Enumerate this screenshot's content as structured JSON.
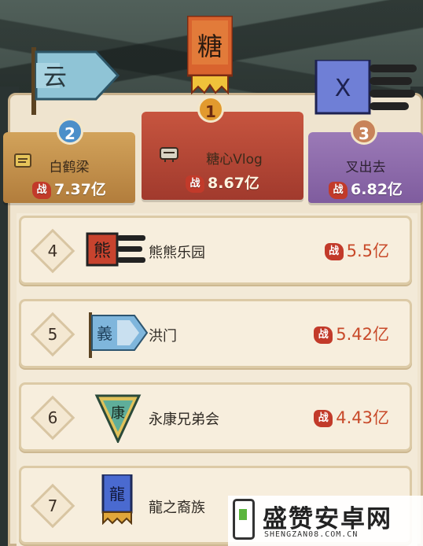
{
  "podium": [
    {
      "rank": "1",
      "name": "糖心Vlog",
      "score": "8.67亿",
      "flag_text": "糖",
      "color": "#b8432f"
    },
    {
      "rank": "2",
      "name": "白鹤梁",
      "score": "7.37亿",
      "flag_text": "云",
      "color": "#c4904a"
    },
    {
      "rank": "3",
      "name": "叉出去",
      "score": "6.82亿",
      "flag_text": "X",
      "color": "#8d6aab"
    }
  ],
  "power_label": "战",
  "list": [
    {
      "rank": "4",
      "name": "熊熊乐园",
      "score": "5.5亿",
      "flag_text": "熊"
    },
    {
      "rank": "5",
      "name": "洪门",
      "score": "5.42亿",
      "flag_text": "義"
    },
    {
      "rank": "6",
      "name": "永康兄弟会",
      "score": "4.43亿",
      "flag_text": "康"
    },
    {
      "rank": "7",
      "name": "龍之裔族",
      "score": "",
      "flag_text": "龍"
    }
  ],
  "watermark": {
    "text": "盛赞安卓网",
    "url": "SHENGZAN08.COM.CN"
  }
}
